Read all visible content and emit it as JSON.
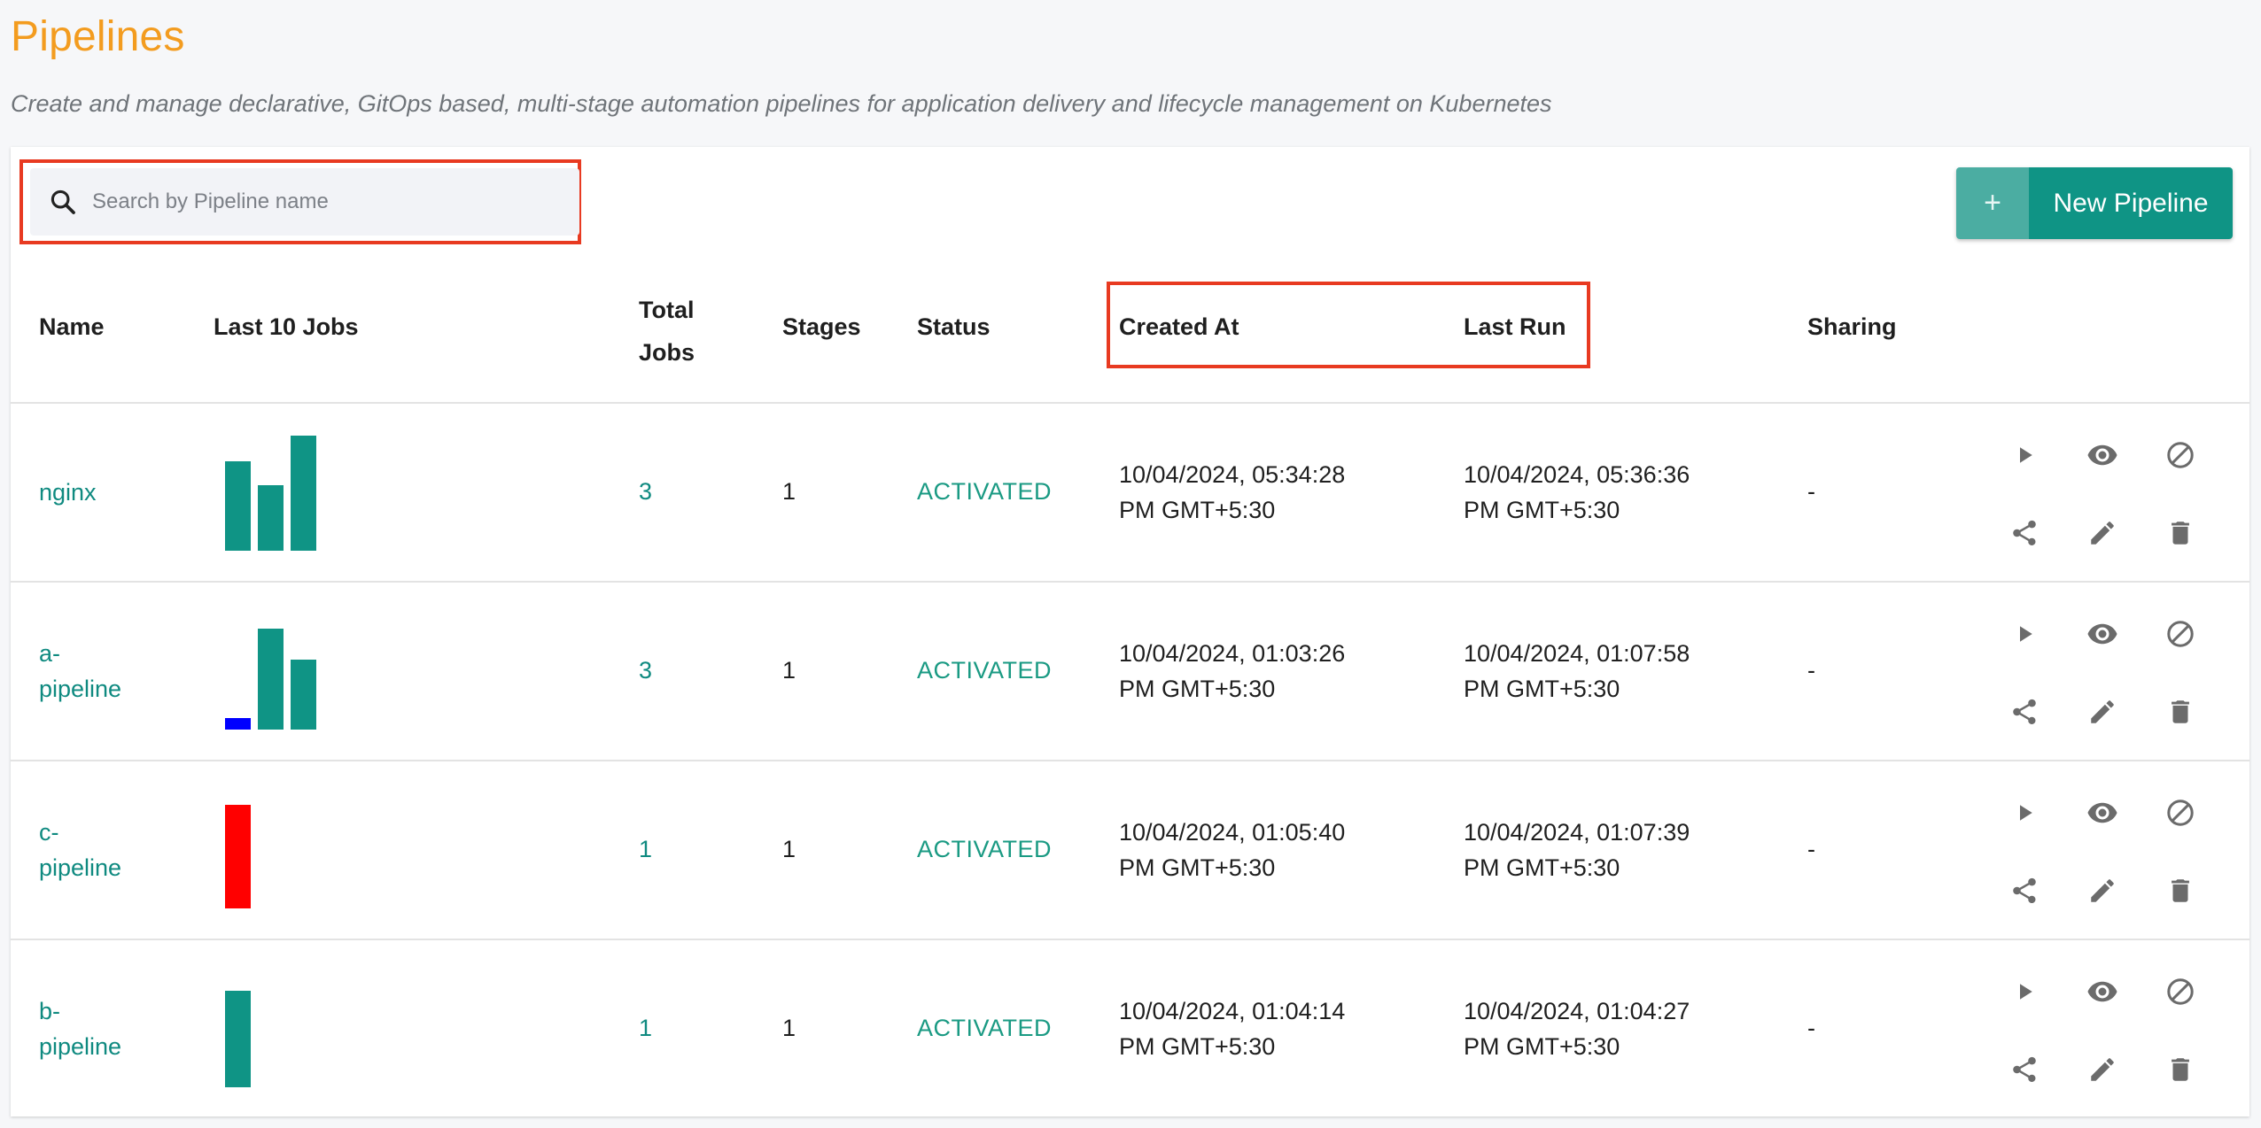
{
  "header": {
    "title": "Pipelines",
    "subtitle": "Create and manage declarative, GitOps based, multi-stage automation pipelines for application delivery and lifecycle management on Kubernetes"
  },
  "search": {
    "placeholder": "Search by Pipeline name",
    "value": ""
  },
  "new_button": {
    "plus": "+",
    "label": "New Pipeline"
  },
  "columns": {
    "name": "Name",
    "last_jobs": "Last 10 Jobs",
    "total_jobs_line1": "Total",
    "total_jobs_line2": "Jobs",
    "stages": "Stages",
    "status": "Status",
    "created_at": "Created At",
    "last_run": "Last Run",
    "sharing": "Sharing"
  },
  "colors": {
    "success": "#0f9485",
    "failed": "#ff0000",
    "running": "#0000ff",
    "title": "#f39c1f",
    "highlight": "#e83a21"
  },
  "actions": [
    "play-icon",
    "eye-icon",
    "block-icon",
    "share-icon",
    "edit-icon",
    "delete-icon"
  ],
  "rows": [
    {
      "name_line1": "nginx",
      "name_line2": "",
      "jobs": [
        {
          "level": 0.78,
          "status": "success"
        },
        {
          "level": 0.57,
          "status": "success"
        },
        {
          "level": 1.0,
          "status": "success"
        }
      ],
      "total_jobs": "3",
      "stages": "1",
      "status": "ACTIVATED",
      "created_line1": "10/04/2024, 05:34:28",
      "created_line2": "PM GMT+5:30",
      "lastrun_line1": "10/04/2024, 05:36:36",
      "lastrun_line2": "PM GMT+5:30",
      "sharing": "-"
    },
    {
      "name_line1": "a-",
      "name_line2": "pipeline",
      "jobs": [
        {
          "level": 0.1,
          "status": "running"
        },
        {
          "level": 0.88,
          "status": "success"
        },
        {
          "level": 0.61,
          "status": "success"
        }
      ],
      "total_jobs": "3",
      "stages": "1",
      "status": "ACTIVATED",
      "created_line1": "10/04/2024, 01:03:26",
      "created_line2": "PM GMT+5:30",
      "lastrun_line1": "10/04/2024, 01:07:58",
      "lastrun_line2": "PM GMT+5:30",
      "sharing": "-"
    },
    {
      "name_line1": "c-",
      "name_line2": "pipeline",
      "jobs": [
        {
          "level": 0.9,
          "status": "failed"
        }
      ],
      "total_jobs": "1",
      "stages": "1",
      "status": "ACTIVATED",
      "created_line1": "10/04/2024, 01:05:40",
      "created_line2": "PM GMT+5:30",
      "lastrun_line1": "10/04/2024, 01:07:39",
      "lastrun_line2": "PM GMT+5:30",
      "sharing": "-"
    },
    {
      "name_line1": "b-",
      "name_line2": "pipeline",
      "jobs": [
        {
          "level": 0.84,
          "status": "success"
        }
      ],
      "total_jobs": "1",
      "stages": "1",
      "status": "ACTIVATED",
      "created_line1": "10/04/2024, 01:04:14",
      "created_line2": "PM GMT+5:30",
      "lastrun_line1": "10/04/2024, 01:04:27",
      "lastrun_line2": "PM GMT+5:30",
      "sharing": "-"
    }
  ]
}
